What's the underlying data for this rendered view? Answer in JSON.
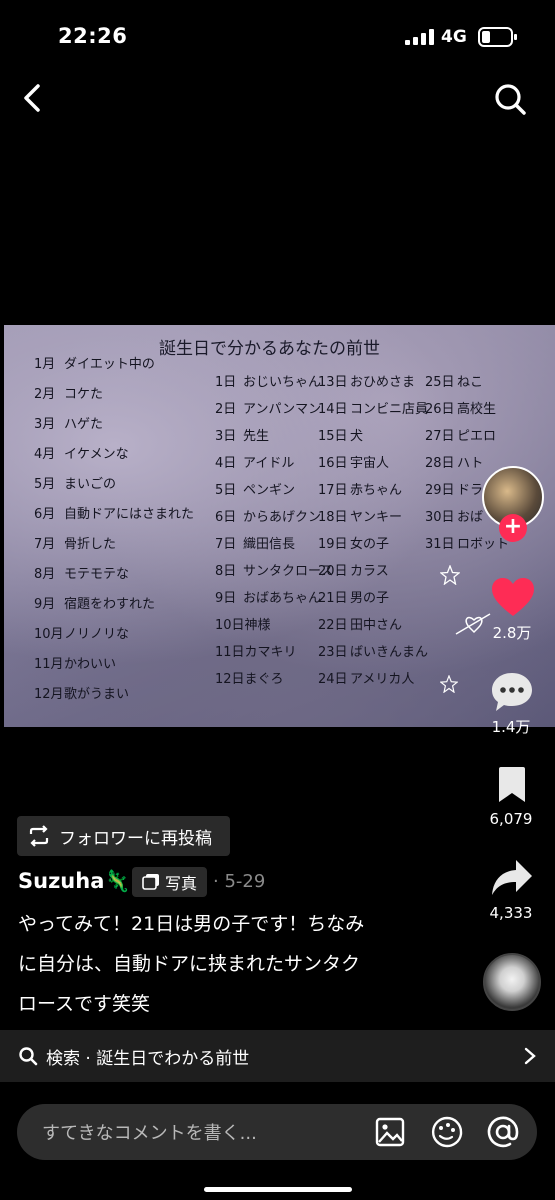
{
  "status": {
    "time": "22:26",
    "network": "4G"
  },
  "image": {
    "title": "誕生日で分かるあなたの前世",
    "months": [
      {
        "n": "1月",
        "t": "ダイエット中の"
      },
      {
        "n": "2月",
        "t": "コケた"
      },
      {
        "n": "3月",
        "t": "ハゲた"
      },
      {
        "n": "4月",
        "t": "イケメンな"
      },
      {
        "n": "5月",
        "t": "まいごの"
      },
      {
        "n": "6月",
        "t": "自動ドアにはさまれた"
      },
      {
        "n": "7月",
        "t": "骨折した"
      },
      {
        "n": "8月",
        "t": "モテモテな"
      },
      {
        "n": "9月",
        "t": "宿題をわすれた"
      },
      {
        "n": "10月",
        "t": "ノリノリな"
      },
      {
        "n": "11月",
        "t": "かわいい"
      },
      {
        "n": "12月",
        "t": "歌がうまい"
      }
    ],
    "days_col1": [
      {
        "n": "1日",
        "t": "おじいちゃん"
      },
      {
        "n": "2日",
        "t": "アンパンマン"
      },
      {
        "n": "3日",
        "t": "先生"
      },
      {
        "n": "4日",
        "t": "アイドル"
      },
      {
        "n": "5日",
        "t": "ペンギン"
      },
      {
        "n": "6日",
        "t": "からあげクン"
      },
      {
        "n": "7日",
        "t": "織田信長"
      },
      {
        "n": "8日",
        "t": "サンタクロース"
      },
      {
        "n": "9日",
        "t": "おばあちゃん"
      },
      {
        "n": "10日",
        "t": "神様"
      },
      {
        "n": "11日",
        "t": "カマキリ"
      },
      {
        "n": "12日",
        "t": "まぐろ"
      }
    ],
    "days_col2": [
      {
        "n": "13日",
        "t": "おひめさま"
      },
      {
        "n": "14日",
        "t": "コンビニ店員"
      },
      {
        "n": "15日",
        "t": "犬"
      },
      {
        "n": "16日",
        "t": "宇宙人"
      },
      {
        "n": "17日",
        "t": "赤ちゃん"
      },
      {
        "n": "18日",
        "t": "ヤンキー"
      },
      {
        "n": "19日",
        "t": "女の子"
      },
      {
        "n": "20日",
        "t": "カラス"
      },
      {
        "n": "21日",
        "t": "男の子"
      },
      {
        "n": "22日",
        "t": "田中さん"
      },
      {
        "n": "23日",
        "t": "ばいきんまん"
      },
      {
        "n": "24日",
        "t": "アメリカ人"
      }
    ],
    "days_col3": [
      {
        "n": "25日",
        "t": "ねこ"
      },
      {
        "n": "26日",
        "t": "高校生"
      },
      {
        "n": "27日",
        "t": "ピエロ"
      },
      {
        "n": "28日",
        "t": "ハト"
      },
      {
        "n": "29日",
        "t": "ドラ"
      },
      {
        "n": "30日",
        "t": "おば"
      },
      {
        "n": "31日",
        "t": "ロボット"
      }
    ]
  },
  "actions": {
    "likes": "2.8万",
    "comments": "1.4万",
    "saves": "6,079",
    "shares": "4,333"
  },
  "post": {
    "repost_label": "フォロワーに再投稿",
    "username": "Suzuha🦎",
    "type_badge": "写真",
    "date": "· 5-29",
    "caption_lines": [
      "やってみて！21日は男の子です！ちなみ",
      "に自分は、自動ドアに挟まれたサンタク",
      "ロースです笑笑"
    ]
  },
  "search_strip": {
    "label": "検索 · 誕生日でわかる前世"
  },
  "comment": {
    "placeholder": "すてきなコメントを書く..."
  },
  "colors": {
    "like": "#fe2c55",
    "background": "#000000"
  }
}
